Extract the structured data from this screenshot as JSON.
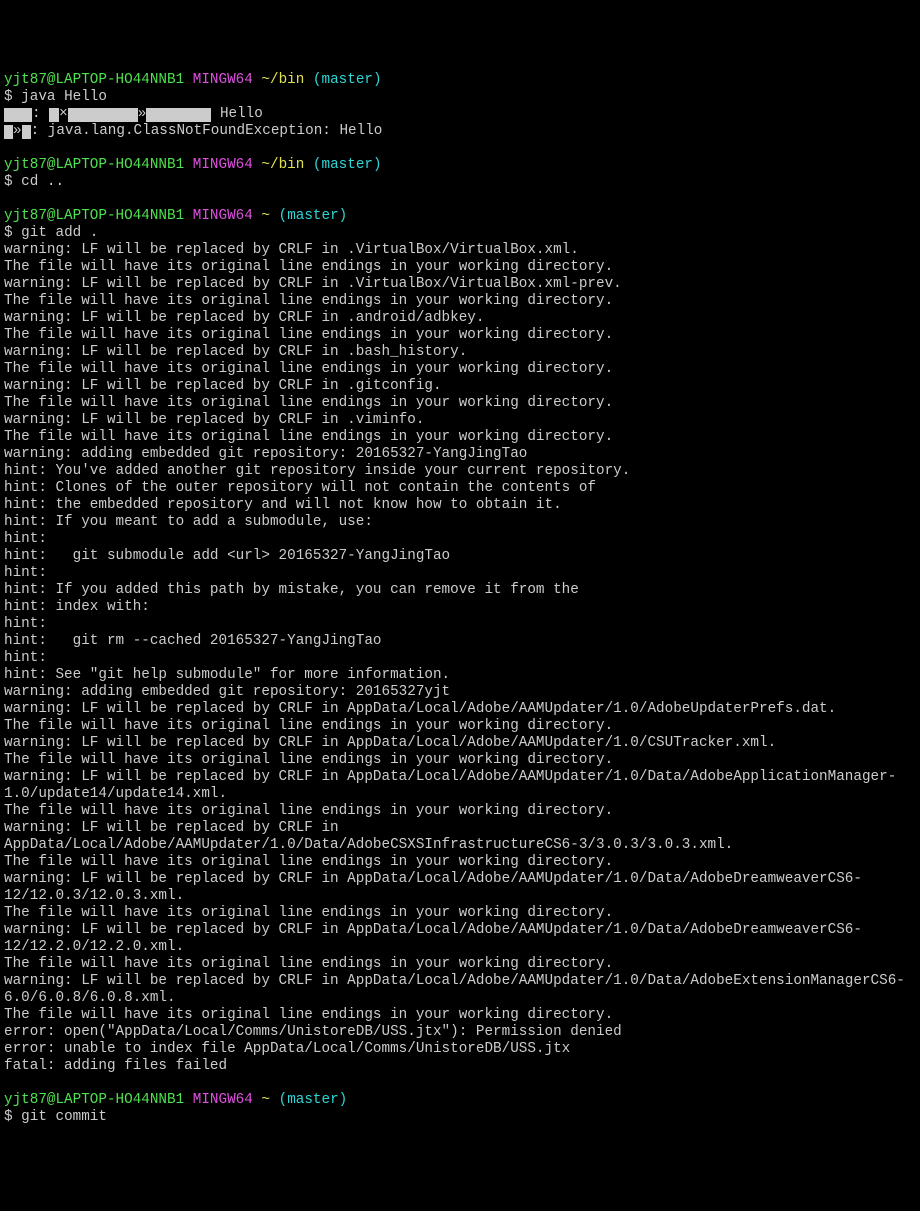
{
  "prompt": {
    "user": "yjt87@LAPTOP-HO44NNB1",
    "mingw": "MINGW64",
    "path_bin": "~/bin",
    "path_home": "~",
    "branch": "(master)"
  },
  "commands": {
    "cmd1": "java Hello",
    "cmd2": "cd ..",
    "cmd3": "git add .",
    "cmd4": "git commit"
  },
  "java_err": {
    "line1_trail": " Hello",
    "line2_trail": ": java.lang.ClassNotFoundException: Hello"
  },
  "output": [
    "warning: LF will be replaced by CRLF in .VirtualBox/VirtualBox.xml.",
    "The file will have its original line endings in your working directory.",
    "warning: LF will be replaced by CRLF in .VirtualBox/VirtualBox.xml-prev.",
    "The file will have its original line endings in your working directory.",
    "warning: LF will be replaced by CRLF in .android/adbkey.",
    "The file will have its original line endings in your working directory.",
    "warning: LF will be replaced by CRLF in .bash_history.",
    "The file will have its original line endings in your working directory.",
    "warning: LF will be replaced by CRLF in .gitconfig.",
    "The file will have its original line endings in your working directory.",
    "warning: LF will be replaced by CRLF in .viminfo.",
    "The file will have its original line endings in your working directory.",
    "warning: adding embedded git repository: 20165327-YangJingTao",
    "hint: You've added another git repository inside your current repository.",
    "hint: Clones of the outer repository will not contain the contents of",
    "hint: the embedded repository and will not know how to obtain it.",
    "hint: If you meant to add a submodule, use:",
    "hint:",
    "hint:   git submodule add <url> 20165327-YangJingTao",
    "hint:",
    "hint: If you added this path by mistake, you can remove it from the",
    "hint: index with:",
    "hint:",
    "hint:   git rm --cached 20165327-YangJingTao",
    "hint:",
    "hint: See \"git help submodule\" for more information.",
    "warning: adding embedded git repository: 20165327yjt",
    "warning: LF will be replaced by CRLF in AppData/Local/Adobe/AAMUpdater/1.0/AdobeUpdaterPrefs.dat.",
    "The file will have its original line endings in your working directory.",
    "warning: LF will be replaced by CRLF in AppData/Local/Adobe/AAMUpdater/1.0/CSUTracker.xml.",
    "The file will have its original line endings in your working directory.",
    "warning: LF will be replaced by CRLF in AppData/Local/Adobe/AAMUpdater/1.0/Data/AdobeApplicationManager-1.0/update14/update14.xml.",
    "The file will have its original line endings in your working directory.",
    "warning: LF will be replaced by CRLF in AppData/Local/Adobe/AAMUpdater/1.0/Data/AdobeCSXSInfrastructureCS6-3/3.0.3/3.0.3.xml.",
    "The file will have its original line endings in your working directory.",
    "warning: LF will be replaced by CRLF in AppData/Local/Adobe/AAMUpdater/1.0/Data/AdobeDreamweaverCS6-12/12.0.3/12.0.3.xml.",
    "The file will have its original line endings in your working directory.",
    "warning: LF will be replaced by CRLF in AppData/Local/Adobe/AAMUpdater/1.0/Data/AdobeDreamweaverCS6-12/12.2.0/12.2.0.xml.",
    "The file will have its original line endings in your working directory.",
    "warning: LF will be replaced by CRLF in AppData/Local/Adobe/AAMUpdater/1.0/Data/AdobeExtensionManagerCS6-6.0/6.0.8/6.0.8.xml.",
    "The file will have its original line endings in your working directory.",
    "error: open(\"AppData/Local/Comms/UnistoreDB/USS.jtx\"): Permission denied",
    "error: unable to index file AppData/Local/Comms/UnistoreDB/USS.jtx",
    "fatal: adding files failed"
  ]
}
